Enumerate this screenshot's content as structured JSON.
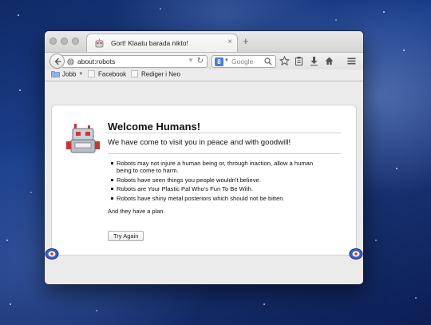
{
  "tab": {
    "title": "Gort! Klaatu barada nikto!",
    "close": "×"
  },
  "new_tab": "+",
  "url": {
    "value": "about:robots"
  },
  "search": {
    "placeholder": "Google",
    "engine_initial": "8"
  },
  "bookmarks": [
    {
      "label": "Jobb",
      "icon": "folder-icon"
    },
    {
      "label": "Facebook",
      "icon": "page-icon"
    },
    {
      "label": "Rediger i Neo",
      "icon": "page-icon"
    }
  ],
  "toolbar_icons": [
    "star-icon",
    "clipboard-icon",
    "download-icon",
    "home-icon",
    "menu-icon"
  ],
  "page": {
    "title": "Welcome Humans!",
    "subtitle": "We have come to visit you in peace and with goodwill!",
    "items": [
      "Robots may not injure a human being or, through inaction, allow a human being to come to harm.",
      "Robots have seen things you people wouldn't believe.",
      "Robots are Your Plastic Pal Who's Fun To Be With.",
      "Robots have shiny metal posteriors which should not be bitten."
    ],
    "plan": "And they have a plan.",
    "button": "Try Again"
  },
  "colors": {
    "desktop": "#1c3f8c",
    "accent": "#4a7cdb"
  }
}
